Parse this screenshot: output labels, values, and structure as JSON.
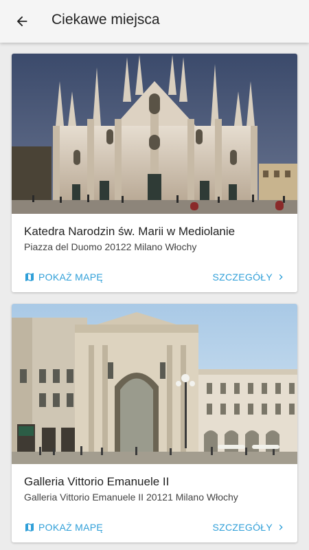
{
  "header": {
    "title": "Ciekawe miejsca",
    "back_icon": "arrow-back-icon"
  },
  "colors": {
    "accent": "#2f9fd8",
    "appbar": "#f5f5f5",
    "background": "#ececec"
  },
  "places": [
    {
      "name": "Katedra Narodzin św. Marii w Mediolanie",
      "address": "Piazza del Duomo 20122 Milano Włochy",
      "show_map_label": "POKAŻ MAPĘ",
      "details_label": "SZCZEGÓŁY",
      "map_icon": "map-icon",
      "details_icon": "chevron-right-icon"
    },
    {
      "name": "Galleria Vittorio Emanuele II",
      "address": "Galleria Vittorio Emanuele II 20121 Milano Włochy",
      "show_map_label": "POKAŻ MAPĘ",
      "details_label": "SZCZEGÓŁY",
      "map_icon": "map-icon",
      "details_icon": "chevron-right-icon"
    }
  ]
}
